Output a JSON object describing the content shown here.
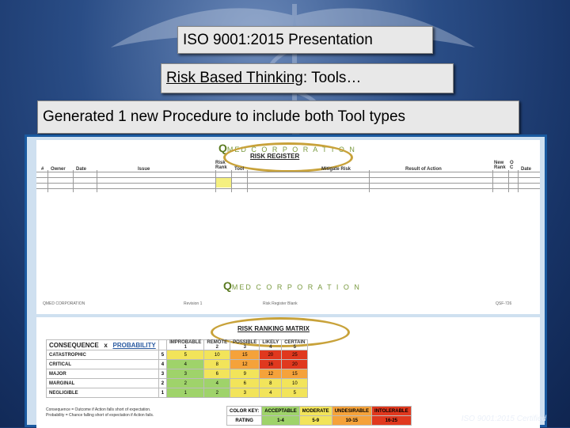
{
  "slide": {
    "title": "ISO 9001:2015 Presentation",
    "subtitle_underlined": "Risk Based Thinking",
    "subtitle_rest": ": Tools…",
    "caption": "Generated 1 new Procedure to include both Tool types"
  },
  "risk_register": {
    "logo_letter": "Q",
    "logo_text": "MED  C O R P O R A T I O N",
    "title": "RISK REGISTER",
    "headers": [
      "#",
      "Owner",
      "Date",
      "Issue",
      "Risk Rank",
      "Tool",
      "Mitigate Risk",
      "Result of Action",
      "New Rank",
      "O C",
      "Date"
    ],
    "footer": [
      "QMED CORPORATION",
      "Revision 1",
      "Risk Register Blank",
      "QSF-726"
    ]
  },
  "risk_ranking_matrix": {
    "title": "RISK RANKING MATRIX",
    "consequence_label": "CONSEQUENCE",
    "times": "x",
    "probability_label": "PROBABILITY",
    "columns": [
      {
        "name": "IMPROBABLE",
        "num": "1"
      },
      {
        "name": "REMOTE",
        "num": "2"
      },
      {
        "name": "POSSIBLE",
        "num": "3"
      },
      {
        "name": "LIKELY",
        "num": "4"
      },
      {
        "name": "CERTAIN",
        "num": "5"
      }
    ],
    "rows": [
      {
        "label": "CATASTROPHIC",
        "rank": "5",
        "cells": [
          "5",
          "10",
          "15",
          "20",
          "25"
        ],
        "colors": [
          "#f2e45a",
          "#f2e45a",
          "#f5a23a",
          "#e0381e",
          "#e0381e"
        ]
      },
      {
        "label": "CRITICAL",
        "rank": "4",
        "cells": [
          "4",
          "8",
          "12",
          "16",
          "20"
        ],
        "colors": [
          "#9fd36a",
          "#f2e45a",
          "#f5a23a",
          "#e0381e",
          "#e0381e"
        ]
      },
      {
        "label": "MAJOR",
        "rank": "3",
        "cells": [
          "3",
          "6",
          "9",
          "12",
          "15"
        ],
        "colors": [
          "#9fd36a",
          "#f2e45a",
          "#f2e45a",
          "#f5a23a",
          "#f5a23a"
        ]
      },
      {
        "label": "MARGINAL",
        "rank": "2",
        "cells": [
          "2",
          "4",
          "6",
          "8",
          "10"
        ],
        "colors": [
          "#9fd36a",
          "#9fd36a",
          "#f2e45a",
          "#f2e45a",
          "#f2e45a"
        ]
      },
      {
        "label": "NEGLIGIBLE",
        "rank": "1",
        "cells": [
          "1",
          "2",
          "3",
          "4",
          "5"
        ],
        "colors": [
          "#9fd36a",
          "#9fd36a",
          "#f2e45a",
          "#f2e45a",
          "#f2e45a"
        ]
      }
    ],
    "notes": [
      "Consequence = Outcome if Action falls short of expectation.",
      "Probability = Chance falling short of expectation if Action fails."
    ],
    "key": {
      "label": "COLOR KEY:",
      "rating_label": "RATING",
      "items": [
        {
          "name": "ACCEPTABLE",
          "range": "1-4",
          "color": "#9fd36a"
        },
        {
          "name": "MODERATE",
          "range": "5-9",
          "color": "#f2e45a"
        },
        {
          "name": "UNDESIRABLE",
          "range": "10-15",
          "color": "#f5a23a"
        },
        {
          "name": "INTOLERABLE",
          "range": "16-25",
          "color": "#e0381e"
        }
      ]
    }
  },
  "stamp": "ISO 9001:2015 Certified"
}
